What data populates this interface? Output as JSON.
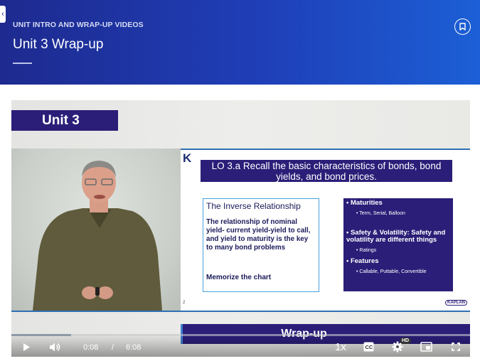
{
  "header": {
    "eyebrow": "UNIT INTRO AND WRAP-UP VIDEOS",
    "title": "Unit 3 Wrap-up",
    "back_icon": "chevron-left-icon",
    "bookmark_icon": "bookmark-icon"
  },
  "video": {
    "unit_banner": "Unit 3",
    "slide": {
      "lo_title": "LO 3.a  Recall the basic characteristics of bonds, bond yields, and bond prices.",
      "inverse_title": "The Inverse Relationship",
      "inverse_body": "The relationship of nominal yield- current yield-yield to call, and yield to maturity is the key to many bond problems",
      "memorize": "Memorize the chart",
      "bullets": [
        {
          "label": "Maturities",
          "sub": "Term, Serial, Balloon"
        },
        {
          "label": "Safety & Volatility: Safety and volatility are different things",
          "sub": "Ratings"
        },
        {
          "label": "Features",
          "sub": "Callable, Puttable, Convertible"
        }
      ],
      "slide_number": "2",
      "brand": "KAPLAN"
    },
    "wrap_banner": "Wrap-up"
  },
  "controls": {
    "current_time": "0:08",
    "separator": "/",
    "duration": "6:08",
    "speed": "1x",
    "hd_badge": "HD",
    "progress_fraction": 0.13,
    "icons": [
      "play-icon",
      "volume-icon",
      "captions-icon",
      "settings-icon",
      "pip-icon",
      "fullscreen-icon"
    ]
  }
}
